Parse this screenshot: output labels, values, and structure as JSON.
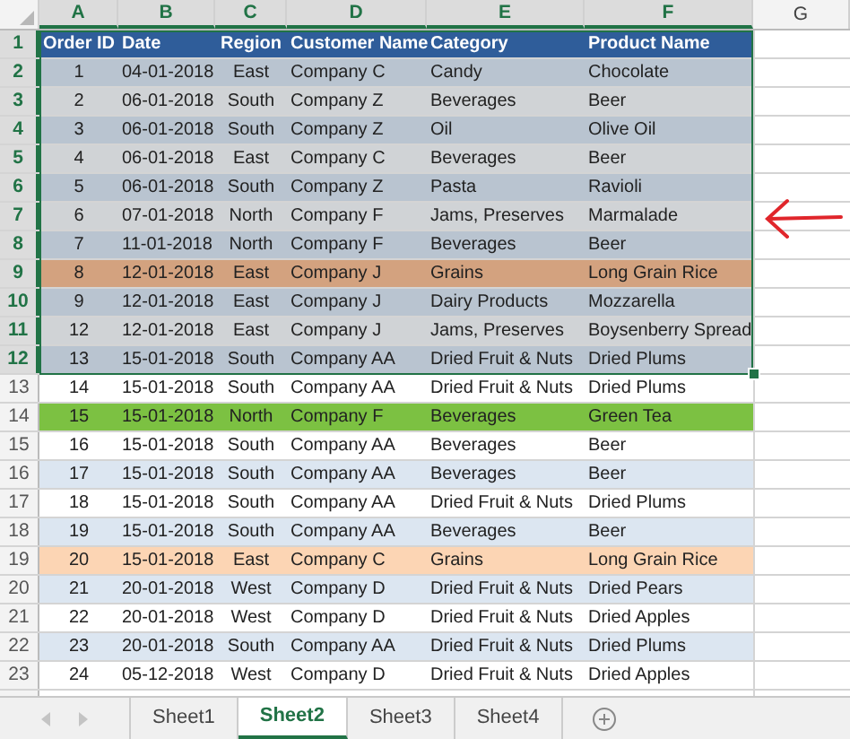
{
  "columns": [
    {
      "label": "A",
      "selected": true
    },
    {
      "label": "B",
      "selected": true
    },
    {
      "label": "C",
      "selected": true
    },
    {
      "label": "D",
      "selected": true
    },
    {
      "label": "E",
      "selected": true
    },
    {
      "label": "F",
      "selected": true
    },
    {
      "label": "G",
      "selected": false
    }
  ],
  "rows": [
    {
      "number": "1",
      "kind": "header",
      "selected": true,
      "color": "#2f5d9a",
      "cells": [
        "Order ID",
        "Date",
        "Region",
        "Customer Name",
        "Category",
        "Product Name"
      ]
    },
    {
      "number": "2",
      "kind": "data",
      "selected": true,
      "color": "#b9c4d0",
      "cells": [
        "1",
        "04-01-2018",
        "East",
        "Company C",
        "Candy",
        "Chocolate"
      ]
    },
    {
      "number": "3",
      "kind": "data",
      "selected": true,
      "color": "#d0d3d6",
      "cells": [
        "2",
        "06-01-2018",
        "South",
        "Company Z",
        "Beverages",
        "Beer"
      ]
    },
    {
      "number": "4",
      "kind": "data",
      "selected": true,
      "color": "#b9c4d0",
      "cells": [
        "3",
        "06-01-2018",
        "South",
        "Company Z",
        "Oil",
        "Olive Oil"
      ]
    },
    {
      "number": "5",
      "kind": "data",
      "selected": true,
      "color": "#d0d3d6",
      "cells": [
        "4",
        "06-01-2018",
        "East",
        "Company C",
        "Beverages",
        "Beer"
      ]
    },
    {
      "number": "6",
      "kind": "data",
      "selected": true,
      "color": "#b9c4d0",
      "cells": [
        "5",
        "06-01-2018",
        "South",
        "Company Z",
        "Pasta",
        "Ravioli"
      ]
    },
    {
      "number": "7",
      "kind": "data",
      "selected": true,
      "color": "#d0d3d6",
      "cells": [
        "6",
        "07-01-2018",
        "North",
        "Company F",
        "Jams, Preserves",
        "Marmalade"
      ]
    },
    {
      "number": "8",
      "kind": "data",
      "selected": true,
      "color": "#b9c4d0",
      "cells": [
        "7",
        "11-01-2018",
        "North",
        "Company F",
        "Beverages",
        "Beer"
      ]
    },
    {
      "number": "9",
      "kind": "data",
      "selected": true,
      "color": "#d3a27f",
      "cells": [
        "8",
        "12-01-2018",
        "East",
        "Company J",
        "Grains",
        "Long Grain Rice"
      ]
    },
    {
      "number": "10",
      "kind": "data",
      "selected": true,
      "color": "#b9c4d0",
      "cells": [
        "9",
        "12-01-2018",
        "East",
        "Company J",
        "Dairy Products",
        "Mozzarella"
      ]
    },
    {
      "number": "11",
      "kind": "data",
      "selected": true,
      "color": "#d0d3d6",
      "cells": [
        "12",
        "12-01-2018",
        "East",
        "Company J",
        "Jams, Preserves",
        "Boysenberry Spread"
      ]
    },
    {
      "number": "12",
      "kind": "data",
      "selected": true,
      "color": "#b9c4d0",
      "cells": [
        "13",
        "15-01-2018",
        "South",
        "Company AA",
        "Dried Fruit & Nuts",
        "Dried Plums"
      ]
    },
    {
      "number": "13",
      "kind": "data",
      "selected": false,
      "color": "#ffffff",
      "cells": [
        "14",
        "15-01-2018",
        "South",
        "Company AA",
        "Dried Fruit & Nuts",
        "Dried Plums"
      ]
    },
    {
      "number": "14",
      "kind": "data",
      "selected": false,
      "color": "#7cc142",
      "cells": [
        "15",
        "15-01-2018",
        "North",
        "Company F",
        "Beverages",
        "Green Tea"
      ]
    },
    {
      "number": "15",
      "kind": "data",
      "selected": false,
      "color": "#ffffff",
      "cells": [
        "16",
        "15-01-2018",
        "South",
        "Company AA",
        "Beverages",
        "Beer"
      ]
    },
    {
      "number": "16",
      "kind": "data",
      "selected": false,
      "color": "#dce6f1",
      "cells": [
        "17",
        "15-01-2018",
        "South",
        "Company AA",
        "Beverages",
        "Beer"
      ]
    },
    {
      "number": "17",
      "kind": "data",
      "selected": false,
      "color": "#ffffff",
      "cells": [
        "18",
        "15-01-2018",
        "South",
        "Company AA",
        "Dried Fruit & Nuts",
        "Dried Plums"
      ]
    },
    {
      "number": "18",
      "kind": "data",
      "selected": false,
      "color": "#dce6f1",
      "cells": [
        "19",
        "15-01-2018",
        "South",
        "Company AA",
        "Beverages",
        "Beer"
      ]
    },
    {
      "number": "19",
      "kind": "data",
      "selected": false,
      "color": "#fcd5b4",
      "cells": [
        "20",
        "15-01-2018",
        "East",
        "Company C",
        "Grains",
        "Long Grain Rice"
      ]
    },
    {
      "number": "20",
      "kind": "data",
      "selected": false,
      "color": "#dce6f1",
      "cells": [
        "21",
        "20-01-2018",
        "West",
        "Company D",
        "Dried Fruit & Nuts",
        "Dried Pears"
      ]
    },
    {
      "number": "21",
      "kind": "data",
      "selected": false,
      "color": "#ffffff",
      "cells": [
        "22",
        "20-01-2018",
        "West",
        "Company D",
        "Dried Fruit & Nuts",
        "Dried Apples"
      ]
    },
    {
      "number": "22",
      "kind": "data",
      "selected": false,
      "color": "#dce6f1",
      "cells": [
        "23",
        "20-01-2018",
        "South",
        "Company AA",
        "Dried Fruit & Nuts",
        "Dried Plums"
      ]
    },
    {
      "number": "23",
      "kind": "data",
      "selected": false,
      "color": "#ffffff",
      "cells": [
        "24",
        "05-12-2018",
        "West",
        "Company D",
        "Dried Fruit & Nuts",
        "Dried Apples"
      ]
    }
  ],
  "sheet_tabs": [
    {
      "label": "Sheet1",
      "selected": false
    },
    {
      "label": "Sheet2",
      "selected": true
    },
    {
      "label": "Sheet3",
      "selected": false
    },
    {
      "label": "Sheet4",
      "selected": false
    }
  ]
}
